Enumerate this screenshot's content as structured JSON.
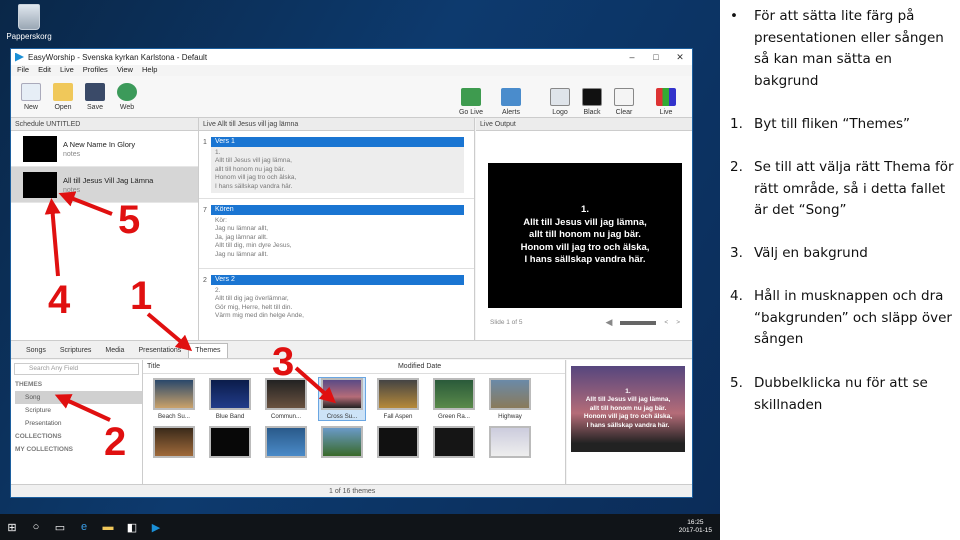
{
  "desktop": {
    "recycle_label": "Papperskorg"
  },
  "app": {
    "title": "EasyWorship - Svenska kyrkan Karlstona - Default",
    "window_controls": [
      "–",
      "□",
      "✕"
    ],
    "menu": [
      "File",
      "Edit",
      "Live",
      "Profiles",
      "View",
      "Help"
    ],
    "toolbar_left": [
      "New",
      "Open",
      "Save",
      "Web"
    ],
    "toolbar_right": [
      "Go Live",
      "Alerts",
      "Logo",
      "Black",
      "Clear",
      "Live"
    ],
    "schedule": {
      "header": "Schedule UNTITLED",
      "items": [
        {
          "title": "A New Name In Glory",
          "notes": "notes"
        },
        {
          "title": "All till Jesus Vill Jag Lämna",
          "notes": "notes"
        }
      ]
    },
    "live": {
      "header": "Live  Allt till Jesus vill jag lämna",
      "slides": [
        {
          "num": "1",
          "label": "Vers 1",
          "lines": [
            "1.",
            "Allt till Jesus vill jag lämna,",
            "allt till honom nu jag bär.",
            "Honom vill jag tro och älska,",
            "I hans sällskap vandra här."
          ]
        },
        {
          "num": "7",
          "label": "Kören",
          "lines": [
            "Kör:",
            "Jag nu lämnar allt,",
            "Ja, jag lämnar allt.",
            "Allt till dig, min dyre Jesus,",
            "Jag nu lämnar allt."
          ]
        },
        {
          "num": "2",
          "label": "Vers 2",
          "lines": [
            "2.",
            "Allt till dig jag överlämnar,",
            "Gör mig, Herre, helt till din.",
            "Värm mig med din helge Ande,",
            "Så jag vet att du är min."
          ]
        }
      ]
    },
    "live_output": {
      "header": "Live Output",
      "lines": [
        "1.",
        "Allt till Jesus vill jag lämna,",
        "allt till honom nu jag bär.",
        "Honom vill jag tro och älska,",
        "I hans sällskap vandra här."
      ],
      "footer": "Slide 1 of 5"
    },
    "tabs": [
      "Songs",
      "Scriptures",
      "Media",
      "Presentations",
      "Themes"
    ],
    "library": {
      "search_placeholder": "Search Any Field",
      "themes_header": "THEMES",
      "theme_items": [
        "Song",
        "Scripture",
        "Presentation"
      ],
      "collections": "COLLECTIONS",
      "my_collections": "MY COLLECTIONS"
    },
    "themes_grid": {
      "col_title": "Title",
      "col_date": "Modified Date",
      "tiles": [
        "Beach Su...",
        "Blue Band",
        "Commun...",
        "Cross Su...",
        "Fall Aspen",
        "Green Ra...",
        "Highway",
        "",
        "",
        "",
        "",
        "",
        "",
        ""
      ],
      "selected": "Cross Su...",
      "count": "1 of 16 themes"
    },
    "preview": {
      "lines": [
        "1.",
        "Allt till Jesus vill jag lämna,",
        "allt till honom nu jag bär.",
        "Honom vill jag tro och älska,",
        "I hans sällskap vandra här."
      ]
    }
  },
  "taskbar": {
    "time": "16:25",
    "date": "2017-01-15"
  },
  "annotations": [
    "5",
    "4",
    "1",
    "3",
    "2"
  ],
  "instructions": [
    {
      "marker": "•",
      "text": "För att sätta lite färg på presentationen eller sången så kan man sätta en bakgrund"
    },
    {
      "marker": "1.",
      "text": "Byt till fliken “Themes”"
    },
    {
      "marker": "2.",
      "text": "Se till att välja rätt Thema för rätt område, så i detta fallet är det “Song”"
    },
    {
      "marker": "3.",
      "text": "Välj en bakgrund"
    },
    {
      "marker": "4.",
      "text": "Håll in musknappen och dra “bakgrunden” och släpp över sången"
    },
    {
      "marker": "5.",
      "text": "Dubbelklicka nu för att se skillnaden"
    }
  ],
  "colors": {
    "arrow": "#e01010",
    "accent": "#1a75d2",
    "desktop": "#0d3a6e"
  }
}
